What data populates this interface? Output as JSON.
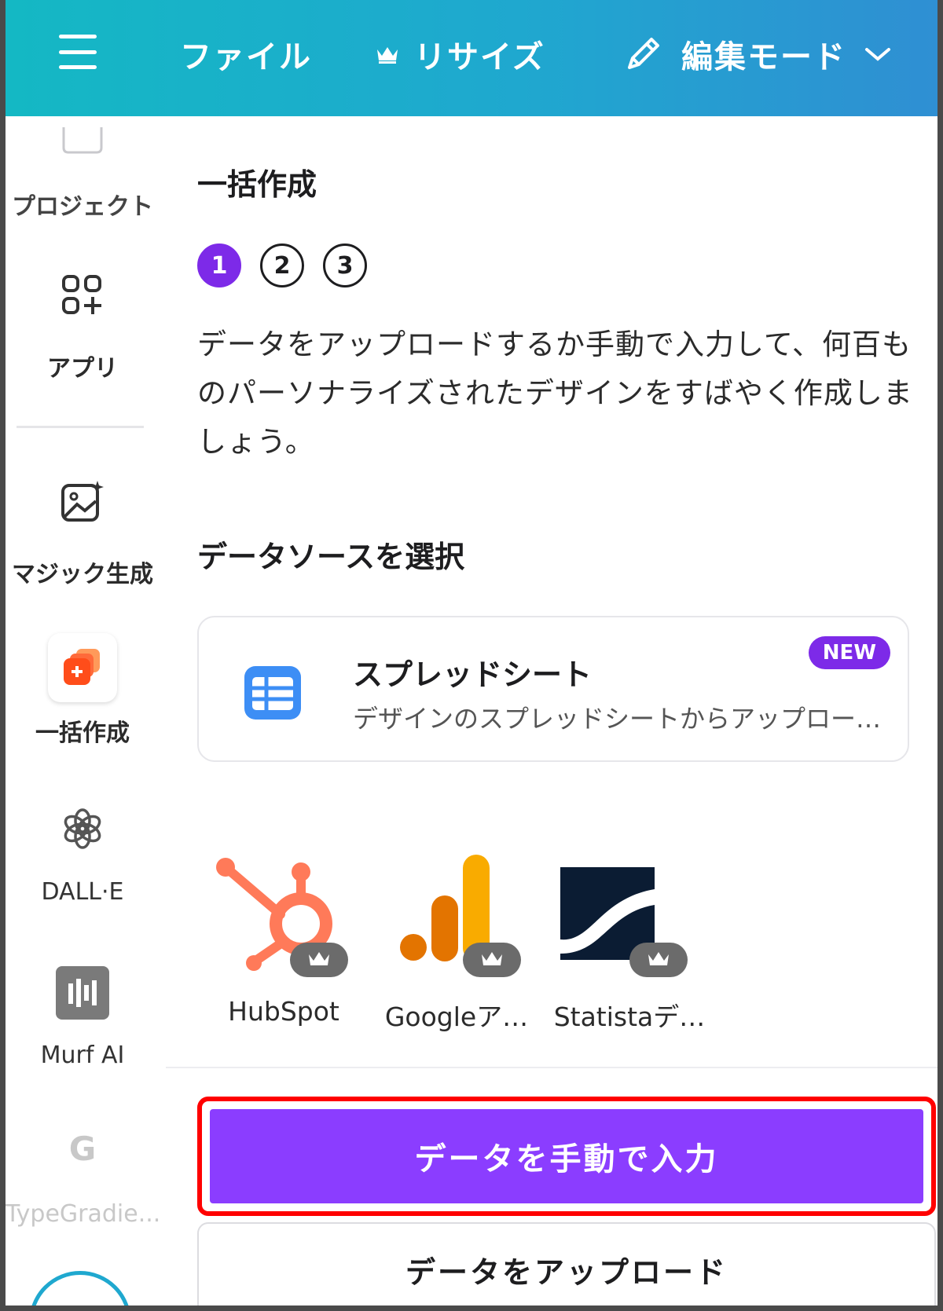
{
  "topbar": {
    "file_label": "ファイル",
    "resize_label": "リサイズ",
    "edit_mode_label": "編集モード"
  },
  "sidebar": {
    "items": [
      {
        "label": "プロジェクト",
        "icon": "folder-icon"
      },
      {
        "label": "アプリ",
        "icon": "apps-grid-icon"
      },
      {
        "label": "マジック生成",
        "icon": "magic-image-icon"
      },
      {
        "label": "一括作成",
        "icon": "bulk-create-icon"
      },
      {
        "label": "DALL·E",
        "icon": "openai-icon"
      },
      {
        "label": "Murf AI",
        "icon": "murf-icon"
      },
      {
        "label": "TypeGradie...",
        "icon": "typegradient-icon"
      }
    ]
  },
  "panel": {
    "title": "一括作成",
    "steps": [
      "1",
      "2",
      "3"
    ],
    "active_step": 1,
    "description": "データをアップロードするか手動で入力して、何百ものパーソナライズされたデザインをすばやく作成しましょう。",
    "data_source_title": "データソースを選択",
    "spreadsheet_card": {
      "title": "スプレッドシート",
      "subtitle": "デザインのスプレッドシートからアップロード…",
      "badge": "NEW"
    },
    "apps": [
      {
        "label": "HubSpot",
        "icon": "hubspot-icon"
      },
      {
        "label": "Googleア…",
        "icon": "google-analytics-icon"
      },
      {
        "label": "Statistaデ…",
        "icon": "statista-icon"
      }
    ],
    "primary_button": "データを手動で入力",
    "secondary_button": "データをアップロード"
  },
  "colors": {
    "accent": "#7d2ae8",
    "primary_button": "#8b3dff",
    "highlight_border": "#ff0000",
    "topbar_start": "#14b8c4",
    "topbar_end": "#2f8fd3"
  }
}
